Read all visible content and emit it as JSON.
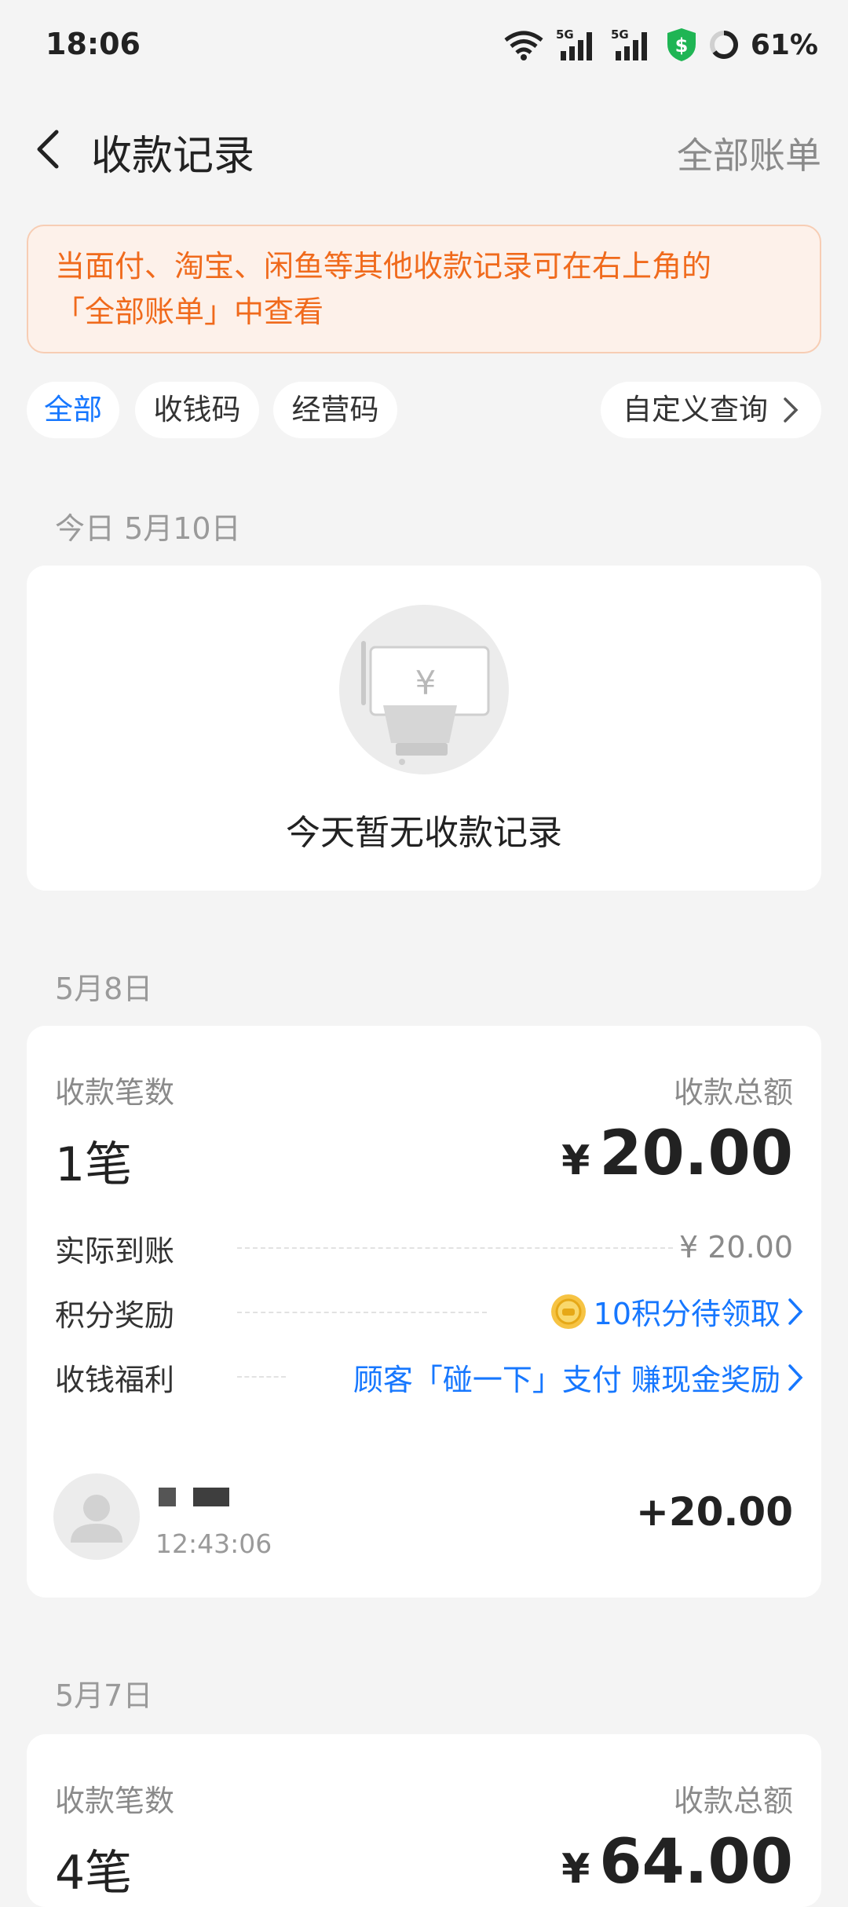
{
  "status_bar": {
    "time": "18:06",
    "battery": "61%",
    "icons": [
      "wifi-icon",
      "signal-5g-icon",
      "signal-5g-icon",
      "shield-icon",
      "battery-ring-icon"
    ]
  },
  "header": {
    "title": "收款记录",
    "right_link": "全部账单"
  },
  "notice": {
    "line1": "当面付、淘宝、闲鱼等其他收款记录可在右上角的",
    "line2": "「全部账单」中查看"
  },
  "filters": {
    "tabs": [
      "全部",
      "收钱码",
      "经营码"
    ],
    "query": "自定义查询"
  },
  "today": {
    "date": "今日 5月10日",
    "empty_text": "今天暂无收款记录"
  },
  "day1": {
    "date": "5月8日",
    "count_label": "收款笔数",
    "count": "1笔",
    "total_label": "收款总额",
    "total_yen": "¥",
    "total": "20.00",
    "rows": [
      {
        "label": "实际到账",
        "value": "¥ 20.00"
      },
      {
        "label": "积分奖励",
        "value": "10积分待领取"
      },
      {
        "label": "收钱福利",
        "value": "顾客「碰一下」支付 赚现金奖励"
      }
    ],
    "transaction": {
      "time": "12:43:06",
      "amount": "+20.00"
    }
  },
  "day2": {
    "date": "5月7日",
    "count_label": "收款笔数",
    "count": "4笔",
    "total_label": "收款总额",
    "total_yen": "¥",
    "total": "64.00"
  },
  "colors": {
    "accent": "#1677ff",
    "notice_text": "#f06a1c",
    "notice_bg": "#fdf1ea"
  }
}
